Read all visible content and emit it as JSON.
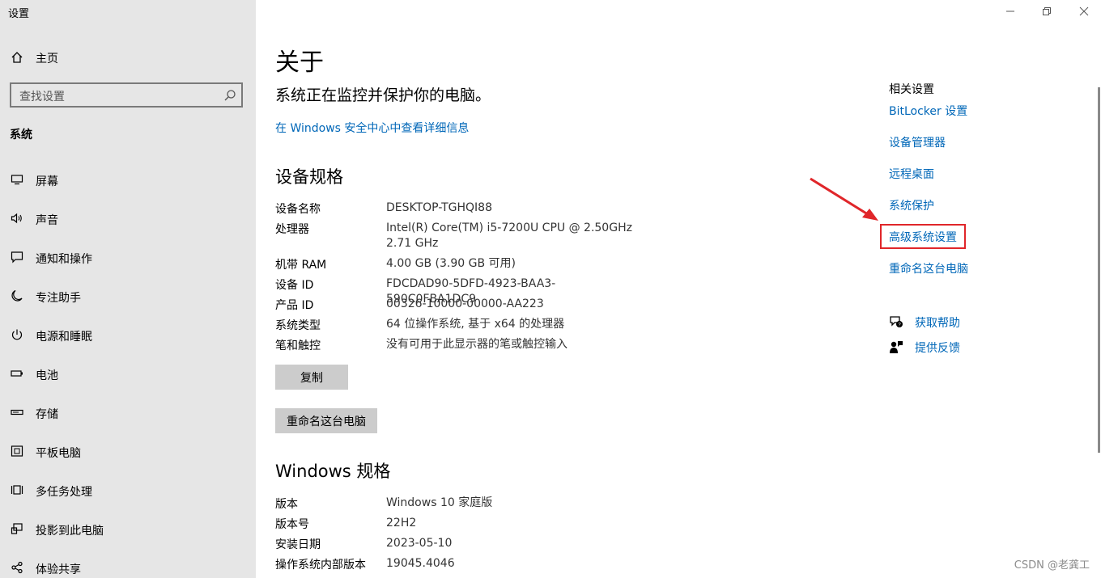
{
  "app": {
    "title": "设置"
  },
  "window": {
    "minimize_icon": "minimize-icon",
    "restore_icon": "restore-icon",
    "close_icon": "close-icon"
  },
  "sidebar": {
    "home_label": "主页",
    "search_placeholder": "查找设置",
    "section_title": "系统",
    "items": [
      {
        "label": "屏幕",
        "icon": "monitor-icon"
      },
      {
        "label": "声音",
        "icon": "speaker-icon"
      },
      {
        "label": "通知和操作",
        "icon": "message-icon"
      },
      {
        "label": "专注助手",
        "icon": "moon-icon"
      },
      {
        "label": "电源和睡眠",
        "icon": "power-icon"
      },
      {
        "label": "电池",
        "icon": "battery-icon"
      },
      {
        "label": "存储",
        "icon": "storage-icon"
      },
      {
        "label": "平板电脑",
        "icon": "tablet-icon"
      },
      {
        "label": "多任务处理",
        "icon": "multitask-icon"
      },
      {
        "label": "投影到此电脑",
        "icon": "project-icon"
      },
      {
        "label": "体验共享",
        "icon": "share-icon"
      }
    ]
  },
  "main": {
    "title": "关于",
    "protect_text": "系统正在监控并保护你的电脑。",
    "security_link": "在 Windows 安全中心中查看详细信息",
    "device_specs": {
      "heading": "设备规格",
      "rows": [
        {
          "key": "设备名称",
          "value": "DESKTOP-TGHQI88"
        },
        {
          "key": "处理器",
          "value": "Intel(R) Core(TM) i5-7200U CPU @ 2.50GHz   2.71 GHz"
        },
        {
          "key": "机带 RAM",
          "value": "4.00 GB (3.90 GB 可用)"
        },
        {
          "key": "设备 ID",
          "value": "FDCDAD90-5DFD-4923-BAA3-590C0FBA1DC9"
        },
        {
          "key": "产品 ID",
          "value": "00326-10000-00000-AA223"
        },
        {
          "key": "系统类型",
          "value": "64 位操作系统, 基于 x64 的处理器"
        },
        {
          "key": "笔和触控",
          "value": "没有可用于此显示器的笔或触控输入"
        }
      ],
      "copy_button": "复制",
      "rename_button": "重命名这台电脑"
    },
    "windows_specs": {
      "heading": "Windows 规格",
      "rows": [
        {
          "key": "版本",
          "value": "Windows 10 家庭版"
        },
        {
          "key": "版本号",
          "value": "22H2"
        },
        {
          "key": "安装日期",
          "value": "2023-05-10"
        },
        {
          "key": "操作系统内部版本",
          "value": "19045.4046"
        }
      ]
    }
  },
  "related": {
    "title": "相关设置",
    "links": [
      "BitLocker 设置",
      "设备管理器",
      "远程桌面",
      "系统保护",
      "高级系统设置",
      "重命名这台电脑"
    ],
    "help": {
      "get_help": "获取帮助",
      "feedback": "提供反馈"
    }
  },
  "annotation": {
    "arrow_color": "#e0262a",
    "highlight_color": "#e0262a"
  },
  "watermark": "CSDN @老龚工",
  "colors": {
    "link": "#0067b8",
    "sidebar_bg": "#e6e6e6",
    "button_bg": "#cccccc"
  }
}
